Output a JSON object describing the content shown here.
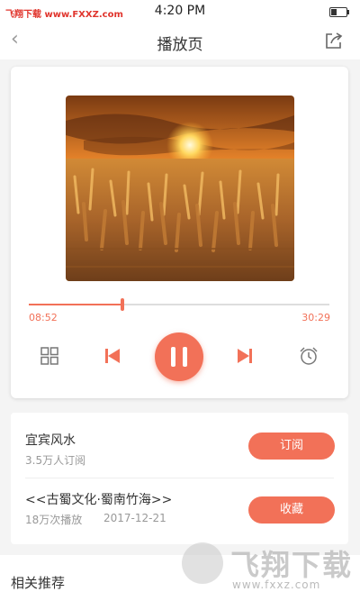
{
  "status_bar": {
    "watermark_text": "飞翔下载 www.FXXZ.com",
    "time": "4:20 PM",
    "battery_icon": "battery-icon"
  },
  "nav": {
    "back_icon": "chevron-left-icon",
    "title": "播放页",
    "share_icon": "share-icon"
  },
  "player": {
    "cover_description": "wheat-field-sunset",
    "current_time": "08:52",
    "total_time": "30:29",
    "progress_fraction": 0.31,
    "controls": [
      "playlist-icon",
      "previous-icon",
      "pause-icon",
      "next-icon",
      "alarm-clock-icon"
    ]
  },
  "album": {
    "title": "宜宾风水",
    "subscribers": "3.5万人订阅",
    "subscribe_label": "订阅"
  },
  "episode": {
    "title": "<<古蜀文化·蜀南竹海>>",
    "plays": "18万次播放",
    "date": "2017-12-21",
    "collect_label": "收藏"
  },
  "related": {
    "title": "相关推荐"
  },
  "watermark": {
    "brand": "飞翔下载",
    "url": "www.fxxz.com"
  },
  "colors": {
    "accent": "#f27158",
    "background": "#f4f4f4"
  }
}
